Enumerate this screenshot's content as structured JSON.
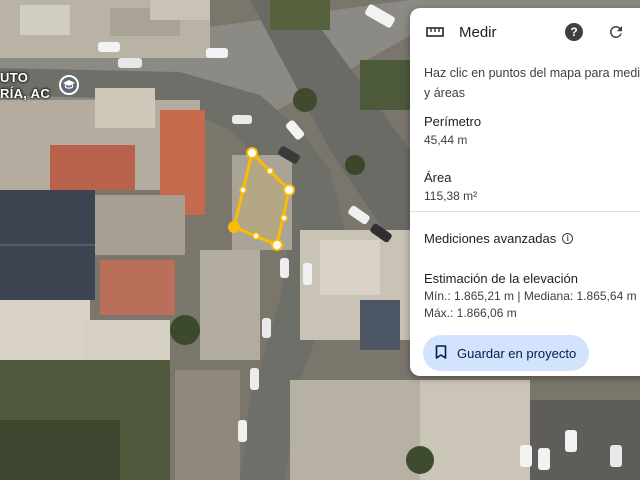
{
  "map": {
    "place_label_line1": "UTO",
    "place_label_line2": "RÍA, AC",
    "poi_icon": "school-icon",
    "measure_color": "#fbbc04"
  },
  "panel": {
    "title": "Medir",
    "title_icon": "ruler-icon",
    "help_icon": "help-icon",
    "help_symbol": "?",
    "refresh_icon": "refresh-icon",
    "instructions_line1": "Haz clic en puntos del mapa para medir",
    "instructions_line2": "y áreas",
    "perimeter_label": "Perímetro",
    "perimeter_value": "45,44 m",
    "area_label": "Área",
    "area_value": "115,38 m²",
    "advanced_label": "Mediciones avanzadas",
    "info_icon": "info-icon",
    "elevation_label": "Estimación de la elevación",
    "elevation_line1": "Mín.: 1.865,21 m | Mediana: 1.865,64 m |",
    "elevation_line2": "Máx.: 1.866,06 m",
    "save_label": "Guardar en proyecto",
    "save_icon": "bookmark-icon",
    "accent_color": "#d3e3fd"
  }
}
